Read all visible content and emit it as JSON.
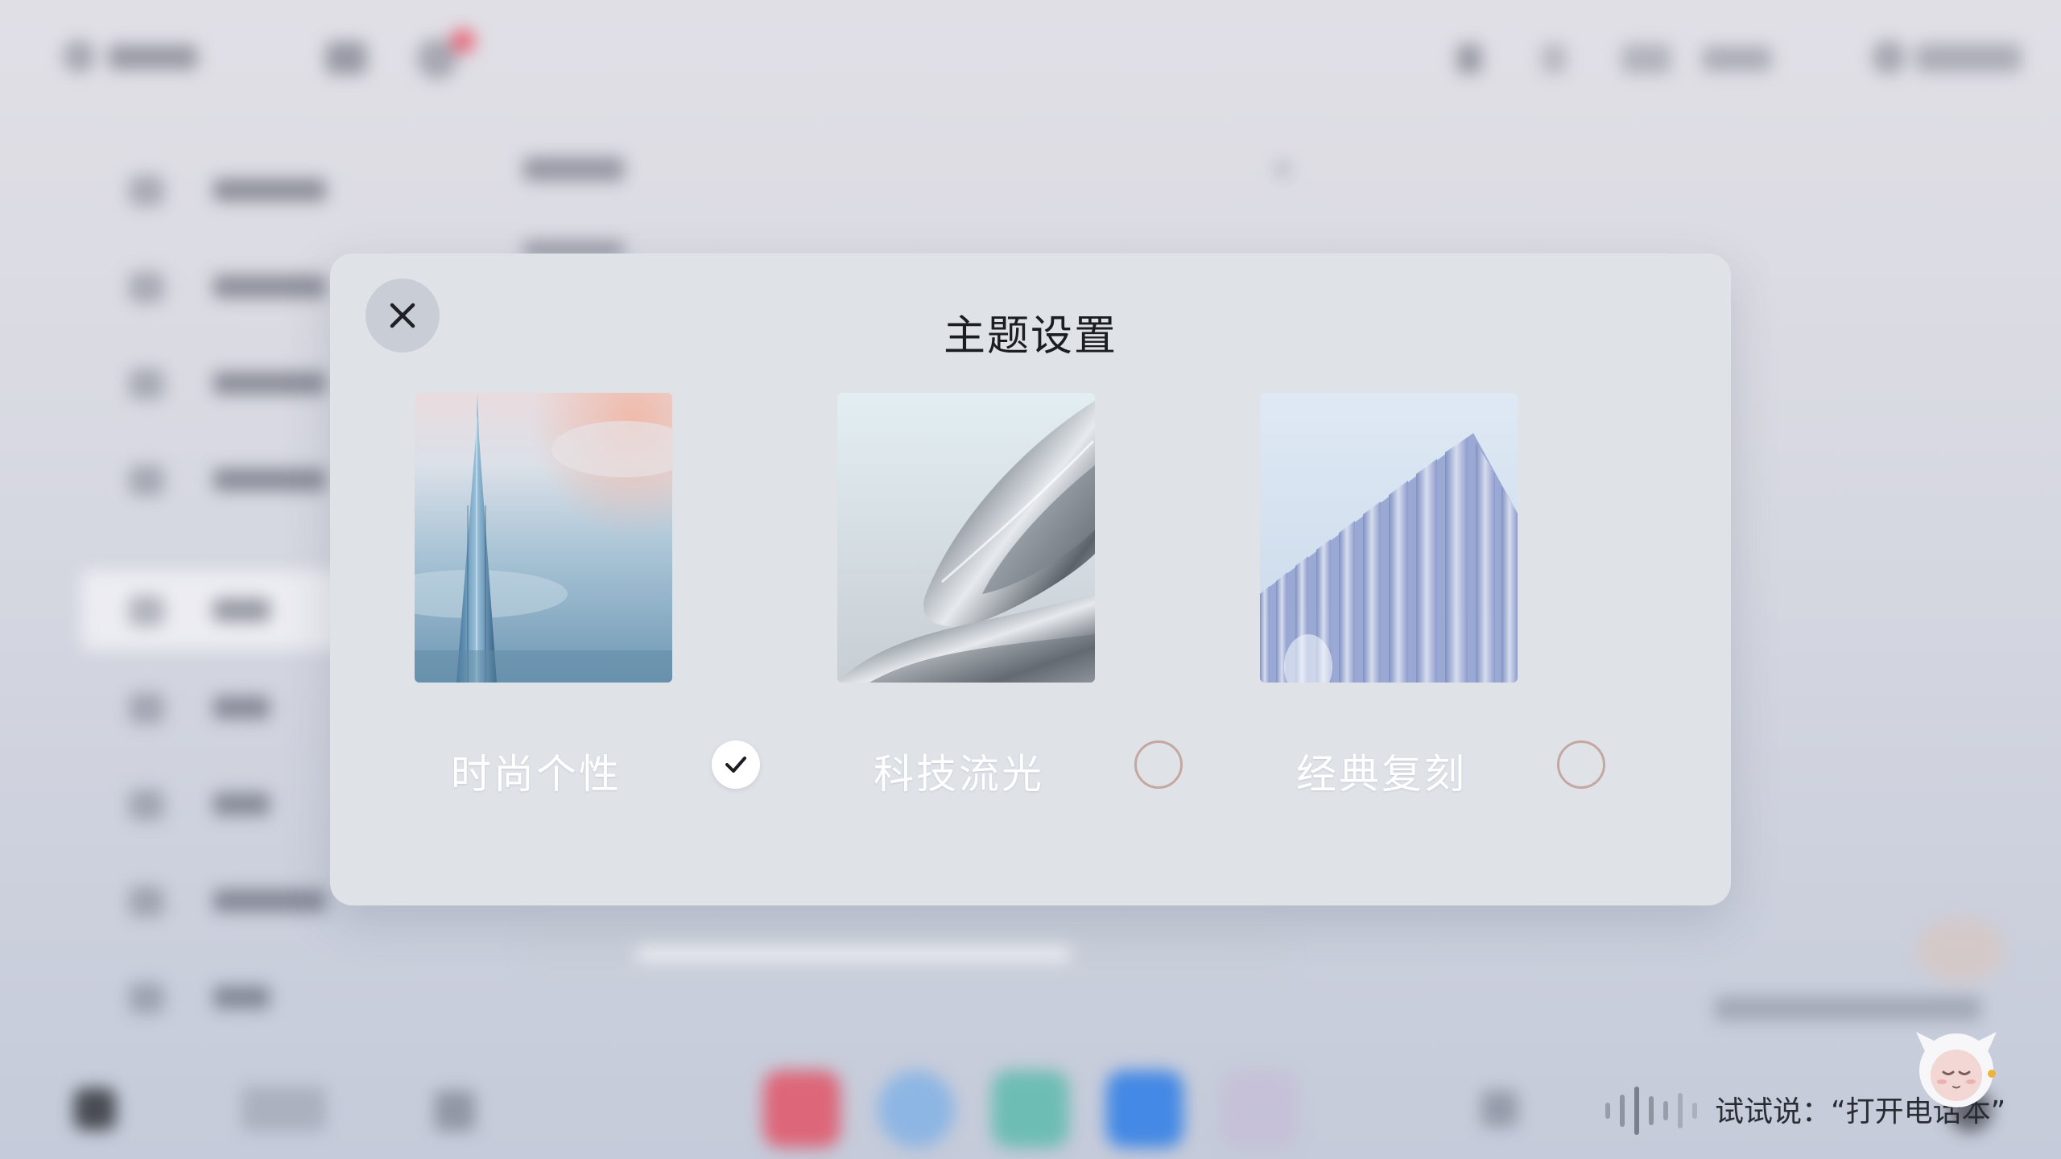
{
  "dialog": {
    "title": "主题设置",
    "close_icon": "close-icon",
    "themes": [
      {
        "id": "fashion",
        "label": "时尚个性",
        "selected": true,
        "image": "skyscraper-spire"
      },
      {
        "id": "tech",
        "label": "科技流光",
        "selected": false,
        "image": "chrome-swirl"
      },
      {
        "id": "classic",
        "label": "经典复刻",
        "selected": false,
        "image": "pleated-facade"
      }
    ]
  },
  "voice_assistant": {
    "hint": "试试说：“打开电话本”",
    "mascot_icon": "cat-mascot-icon"
  },
  "colors": {
    "dialog_bg": "#dfe3e8",
    "close_bg": "#c9ced6",
    "radio_off_border": "#c4a7a0",
    "accent_red": "#e84a5f"
  }
}
